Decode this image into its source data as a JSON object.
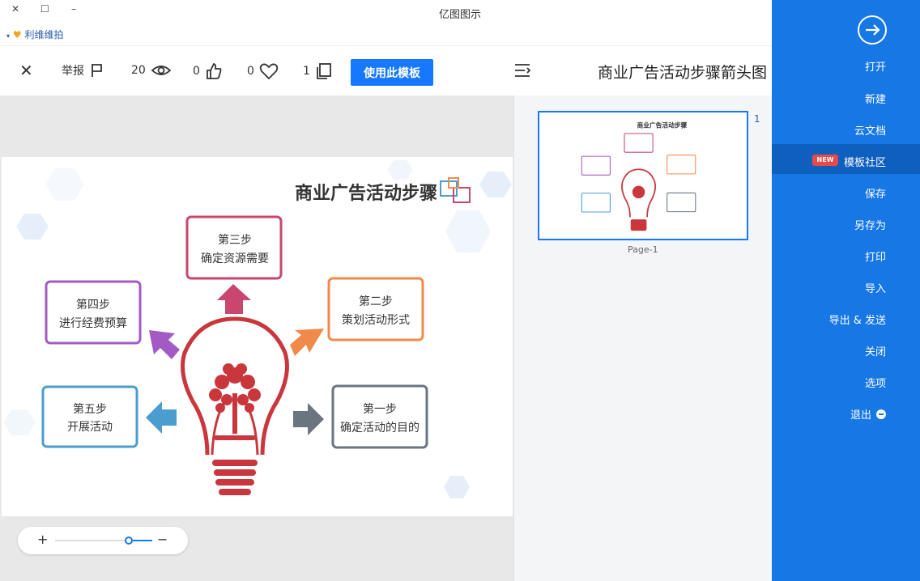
{
  "window": {
    "title": "亿图图示",
    "user": "利维维拍"
  },
  "toolbar": {
    "close_label": "✕",
    "report_label": "举报",
    "views": "20",
    "likes": "0",
    "favorites": "0",
    "copies": "1",
    "use_template": "使用此模板",
    "doc_title": "商业广告活动步骤箭头图"
  },
  "diagram": {
    "title": "商业广告活动步骤",
    "steps": [
      {
        "title": "第一步",
        "desc": "确定活动的目的",
        "color": "#6b7580"
      },
      {
        "title": "第二步",
        "desc": "策划活动形式",
        "color": "#f08a4b"
      },
      {
        "title": "第三步",
        "desc": "确定资源需要",
        "color": "#c9466e"
      },
      {
        "title": "第四步",
        "desc": "进行经费预算",
        "color": "#a25bc4"
      },
      {
        "title": "第五步",
        "desc": "开展活动",
        "color": "#4b9ccf"
      }
    ],
    "bulb_color": "#c9373d"
  },
  "zoom": {
    "plus": "+",
    "minus": "−"
  },
  "pages": {
    "number": "1",
    "label": "Page-1"
  },
  "sidebar": {
    "items": [
      {
        "label": "打开"
      },
      {
        "label": "新建"
      },
      {
        "label": "云文档"
      },
      {
        "label": "模板社区",
        "badge": "NEW",
        "active": true
      },
      {
        "label": "保存"
      },
      {
        "label": "另存为"
      },
      {
        "label": "打印"
      },
      {
        "label": "导入"
      },
      {
        "label": "导出 & 发送"
      },
      {
        "label": "关闭"
      },
      {
        "label": "选项"
      },
      {
        "label": "退出"
      }
    ]
  },
  "colors": {
    "accent": "#1677ff",
    "sidebar": "#1677e5",
    "sidebar_active": "#0f5fbf",
    "badge": "#e84a4a"
  }
}
